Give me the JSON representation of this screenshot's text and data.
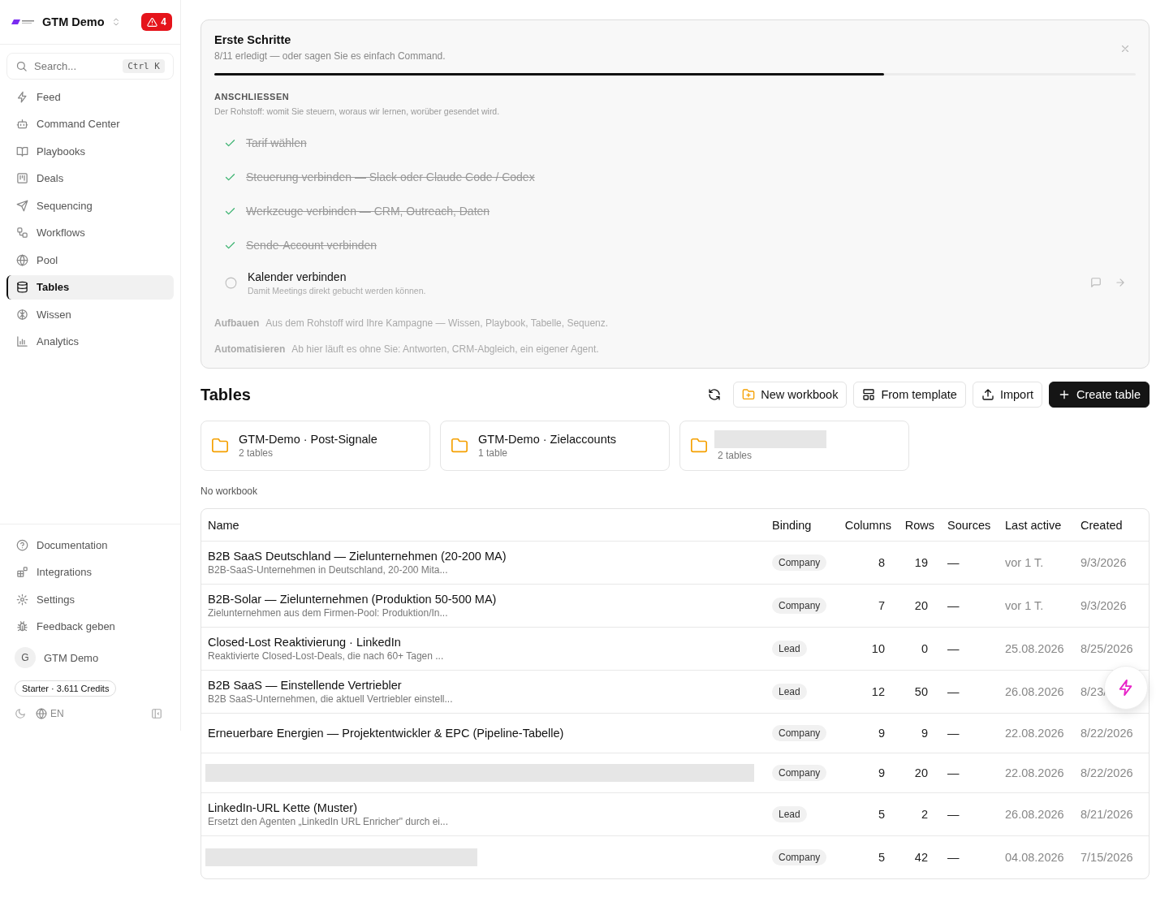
{
  "sidebar": {
    "workspace": "GTM Demo",
    "alert_count": "4",
    "search": {
      "placeholder": "Search...",
      "shortcut": "Ctrl K"
    },
    "nav": [
      {
        "label": "Feed",
        "selected": false
      },
      {
        "label": "Command Center",
        "selected": false
      },
      {
        "label": "Playbooks",
        "selected": false
      },
      {
        "label": "Deals",
        "selected": false
      },
      {
        "label": "Sequencing",
        "selected": false
      },
      {
        "label": "Workflows",
        "selected": false
      },
      {
        "label": "Pool",
        "selected": false
      },
      {
        "label": "Tables",
        "selected": true
      },
      {
        "label": "Wissen",
        "selected": false
      },
      {
        "label": "Analytics",
        "selected": false
      }
    ],
    "links": [
      {
        "label": "Documentation"
      },
      {
        "label": "Integrations"
      },
      {
        "label": "Settings"
      },
      {
        "label": "Feedback geben"
      }
    ],
    "user": {
      "initial": "G",
      "name": "GTM Demo"
    },
    "plan": "Starter · 3.611 Credits",
    "language": "EN"
  },
  "onboarding": {
    "title": "Erste Schritte",
    "subtitle": "8/11 erledigt — oder sagen Sie es einfach Command.",
    "level": 0.727,
    "section": {
      "heading": "ANSCHLIESSEN",
      "description": "Der Rohstoff: womit Sie steuern, woraus wir lernen, worüber gesendet wird.",
      "steps": [
        {
          "label": "Tarif wählen",
          "done": true
        },
        {
          "label": "Steuerung verbinden — Slack oder Claude Code / Codex",
          "done": true
        },
        {
          "label": "Werkzeuge verbinden — CRM, Outreach, Daten",
          "done": true
        },
        {
          "label": "Sende-Account verbinden",
          "done": true
        },
        {
          "label": "Kalender verbinden",
          "description": "Damit Meetings direkt gebucht werden können.",
          "done": false
        }
      ]
    },
    "phases": [
      {
        "name": "Aufbauen",
        "description": "Aus dem Rohstoff wird Ihre Kampagne — Wissen, Playbook, Tabelle, Sequenz."
      },
      {
        "name": "Automatisieren",
        "description": "Ab hier läuft es ohne Sie: Antworten, CRM-Abgleich, ein eigener Agent."
      }
    ]
  },
  "page": {
    "title": "Tables",
    "actions": [
      {
        "label": "New workbook",
        "kind": "outline"
      },
      {
        "label": "From template",
        "kind": "outline"
      },
      {
        "label": "Import",
        "kind": "outline"
      },
      {
        "label": "Create table",
        "kind": "primary"
      }
    ]
  },
  "workbooks": [
    {
      "name": "GTM-Demo · Post-Signale",
      "count": "2 tables"
    },
    {
      "name": "GTM-Demo · Zielaccounts",
      "count": "1 table"
    },
    {
      "redacted": true,
      "count": "2 tables"
    }
  ],
  "no_workbook_label": "No workbook",
  "table": {
    "columns": [
      "Name",
      "Binding",
      "Columns",
      "Rows",
      "Sources",
      "Last active",
      "Created"
    ],
    "rows": [
      {
        "name": "B2B SaaS Deutschland — Zielunternehmen (20-200 MA)",
        "description": "B2B-SaaS-Unternehmen in Deutschland, 20-200 Mita...",
        "binding": "Company",
        "columns": "8",
        "rows": "19",
        "sources": "—",
        "last_active": "vor 1 T.",
        "created": "9/3/2026"
      },
      {
        "name": "B2B-Solar — Zielunternehmen (Produktion 50-500 MA)",
        "description": "Zielunternehmen aus dem Firmen-Pool: Produktion/In...",
        "binding": "Company",
        "columns": "7",
        "rows": "20",
        "sources": "—",
        "last_active": "vor 1 T.",
        "created": "9/3/2026"
      },
      {
        "name": "Closed-Lost Reaktivierung · LinkedIn",
        "description": "Reaktivierte Closed-Lost-Deals, die nach 60+ Tagen ...",
        "binding": "Lead",
        "columns": "10",
        "rows": "0",
        "sources": "—",
        "last_active": "25.08.2026",
        "created": "8/25/2026"
      },
      {
        "name": "B2B SaaS — Einstellende Vertriebler",
        "description": "B2B SaaS-Unternehmen, die aktuell Vertriebler einstell...",
        "binding": "Lead",
        "columns": "12",
        "rows": "50",
        "sources": "—",
        "last_active": "26.08.2026",
        "created": "8/23/"
      },
      {
        "name": "Erneuerbare Energien — Projektentwickler & EPC (Pipeline-Tabelle)",
        "binding": "Company",
        "columns": "9",
        "rows": "9",
        "sources": "—",
        "last_active": "22.08.2026",
        "created": "8/22/2026"
      },
      {
        "redacted": true,
        "binding": "Company",
        "columns": "9",
        "rows": "20",
        "sources": "—",
        "last_active": "22.08.2026",
        "created": "8/22/2026"
      },
      {
        "name": "LinkedIn-URL Kette (Muster)",
        "description": "Ersetzt den Agenten „LinkedIn URL Enricher\" durch ei...",
        "binding": "Lead",
        "columns": "5",
        "rows": "2",
        "sources": "—",
        "last_active": "26.08.2026",
        "created": "8/21/2026"
      },
      {
        "redacted": true,
        "binding": "Company",
        "columns": "5",
        "rows": "42",
        "sources": "—",
        "last_active": "04.08.2026",
        "created": "7/15/2026"
      }
    ]
  }
}
